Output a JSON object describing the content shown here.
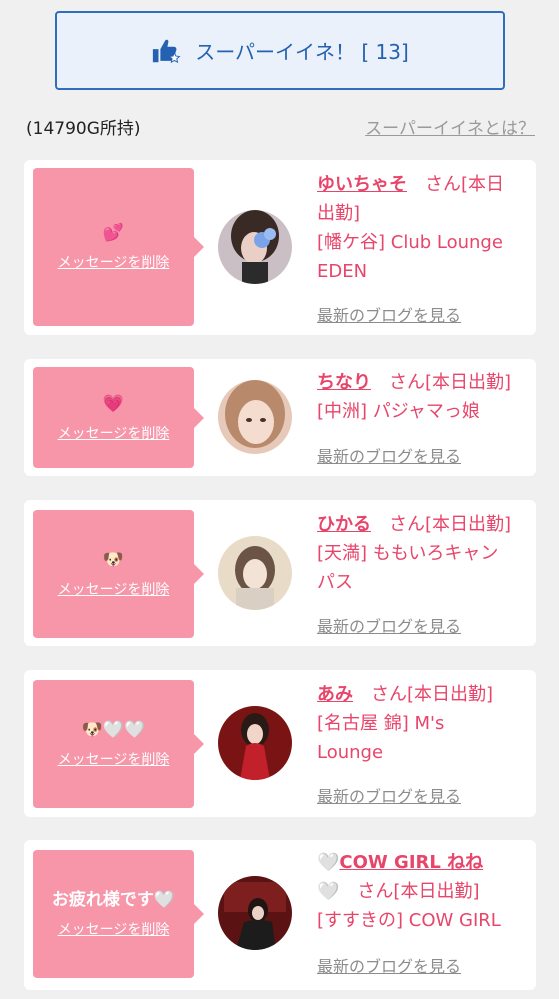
{
  "super_like_button": {
    "label": "スーパーイイネ！ [ 13]"
  },
  "balance": "(14790G所持)",
  "about_link": "スーパーイイネとは？",
  "items": [
    {
      "message": "💕",
      "delete": "メッセージを削除",
      "name": "ゆいちゃそ",
      "line1_rest": "　さん[本日",
      "line2": "出勤]",
      "line3": "[幡ケ谷] Club Lounge",
      "line4": "EDEN",
      "blog": "最新のブログを見る"
    },
    {
      "message": "💗",
      "delete": "メッセージを削除",
      "name": "ちなり",
      "line1_rest": "　さん[本日出勤]",
      "line2": "[中洲] パジャマっ娘",
      "blog": "最新のブログを見る"
    },
    {
      "message": "🐶",
      "delete": "メッセージを削除",
      "name": "ひかる",
      "line1_rest": "　さん[本日出勤]",
      "line2": "[天満] ももいろキャン",
      "line3": "パス",
      "blog": "最新のブログを見る"
    },
    {
      "message": "🐶🤍🤍",
      "delete": "メッセージを削除",
      "name": "あみ",
      "line1_rest": "　さん[本日出勤]",
      "line2": "[名古屋 錦] M's",
      "line3": "Lounge",
      "blog": "最新のブログを見る"
    },
    {
      "message": "お疲れ様です🤍",
      "delete": "メッセージを削除",
      "name_prefix": "🤍",
      "name": "COW GIRL ねね",
      "line2_prefix": "🤍",
      "line2": "　さん[本日出勤]",
      "line3": "[すすきの] COW GIRL",
      "blog": "最新のブログを見る"
    }
  ]
}
